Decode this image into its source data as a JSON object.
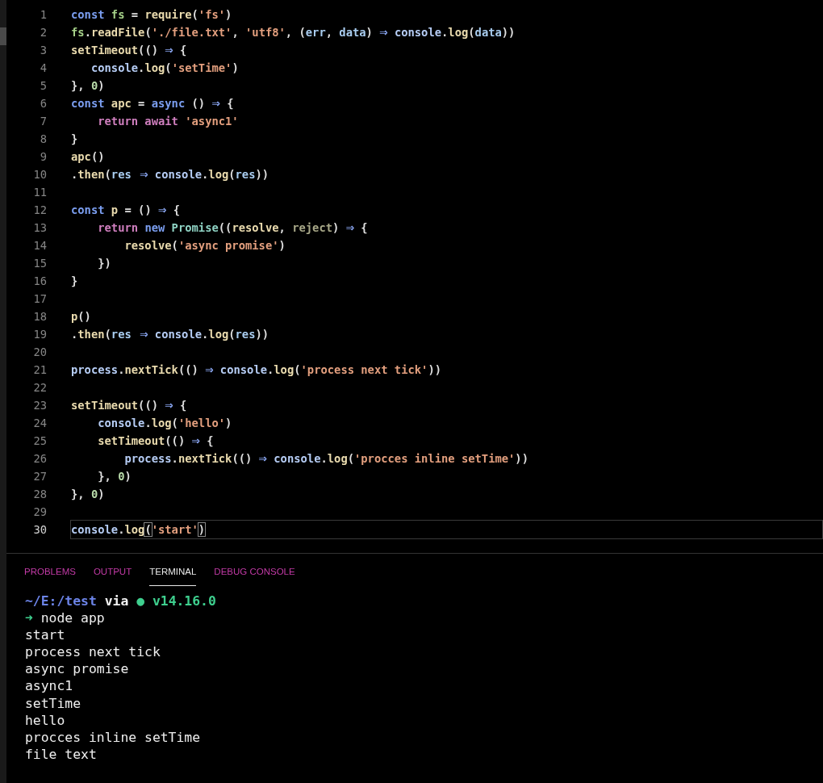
{
  "editor": {
    "lines": [
      {
        "number": "1",
        "current": false,
        "tokens": [
          {
            "kind": "kw",
            "text": "const"
          },
          {
            "kind": "var",
            "text": " fs"
          },
          {
            "kind": "pun",
            "text": " = "
          },
          {
            "kind": "fn",
            "text": "require"
          },
          {
            "kind": "pun",
            "text": "("
          },
          {
            "kind": "str",
            "text": "'fs'"
          },
          {
            "kind": "pun",
            "text": ")"
          }
        ]
      },
      {
        "number": "2",
        "current": false,
        "tokens": [
          {
            "kind": "var",
            "text": "fs"
          },
          {
            "kind": "pun",
            "text": "."
          },
          {
            "kind": "fn",
            "text": "readFile"
          },
          {
            "kind": "pun",
            "text": "("
          },
          {
            "kind": "str",
            "text": "'./file.txt'"
          },
          {
            "kind": "pun",
            "text": ", "
          },
          {
            "kind": "str",
            "text": "'utf8'"
          },
          {
            "kind": "pun",
            "text": ", ("
          },
          {
            "kind": "param",
            "text": "err"
          },
          {
            "kind": "pun",
            "text": ", "
          },
          {
            "kind": "param",
            "text": "data"
          },
          {
            "kind": "pun",
            "text": ") "
          },
          {
            "kind": "op",
            "text": "⇒"
          },
          {
            "kind": "obj",
            "text": " console"
          },
          {
            "kind": "pun",
            "text": "."
          },
          {
            "kind": "fn",
            "text": "log"
          },
          {
            "kind": "pun",
            "text": "("
          },
          {
            "kind": "param",
            "text": "data"
          },
          {
            "kind": "pun",
            "text": "))"
          }
        ]
      },
      {
        "number": "3",
        "current": false,
        "tokens": [
          {
            "kind": "fn",
            "text": "setTimeout"
          },
          {
            "kind": "pun",
            "text": "(() "
          },
          {
            "kind": "op",
            "text": "⇒"
          },
          {
            "kind": "pun",
            "text": " {"
          }
        ]
      },
      {
        "number": "4",
        "current": false,
        "tokens": [
          {
            "kind": "obj",
            "text": "   console"
          },
          {
            "kind": "pun",
            "text": "."
          },
          {
            "kind": "fn",
            "text": "log"
          },
          {
            "kind": "pun",
            "text": "("
          },
          {
            "kind": "str",
            "text": "'setTime'"
          },
          {
            "kind": "pun",
            "text": ")"
          }
        ]
      },
      {
        "number": "5",
        "current": false,
        "tokens": [
          {
            "kind": "pun",
            "text": "}, "
          },
          {
            "kind": "num",
            "text": "0"
          },
          {
            "kind": "pun",
            "text": ")"
          }
        ]
      },
      {
        "number": "6",
        "current": false,
        "tokens": [
          {
            "kind": "kw",
            "text": "const"
          },
          {
            "kind": "fn",
            "text": " apc"
          },
          {
            "kind": "pun",
            "text": " = "
          },
          {
            "kind": "kw",
            "text": "async"
          },
          {
            "kind": "pun",
            "text": " () "
          },
          {
            "kind": "op",
            "text": "⇒"
          },
          {
            "kind": "pun",
            "text": " {"
          }
        ]
      },
      {
        "number": "7",
        "current": false,
        "tokens": [
          {
            "kind": "ctl",
            "text": "    return await"
          },
          {
            "kind": "str",
            "text": " 'async1'"
          }
        ]
      },
      {
        "number": "8",
        "current": false,
        "tokens": [
          {
            "kind": "pun",
            "text": "}"
          }
        ]
      },
      {
        "number": "9",
        "current": false,
        "tokens": [
          {
            "kind": "fn",
            "text": "apc"
          },
          {
            "kind": "pun",
            "text": "()"
          }
        ]
      },
      {
        "number": "10",
        "current": false,
        "tokens": [
          {
            "kind": "pun",
            "text": "."
          },
          {
            "kind": "fn",
            "text": "then"
          },
          {
            "kind": "pun",
            "text": "("
          },
          {
            "kind": "param",
            "text": "res"
          },
          {
            "kind": "op",
            "text": " ⇒"
          },
          {
            "kind": "obj",
            "text": " console"
          },
          {
            "kind": "pun",
            "text": "."
          },
          {
            "kind": "fn",
            "text": "log"
          },
          {
            "kind": "pun",
            "text": "("
          },
          {
            "kind": "param",
            "text": "res"
          },
          {
            "kind": "pun",
            "text": "))"
          }
        ]
      },
      {
        "number": "11",
        "current": false
      },
      {
        "number": "12",
        "current": false,
        "tokens": [
          {
            "kind": "kw",
            "text": "const"
          },
          {
            "kind": "fn",
            "text": " p"
          },
          {
            "kind": "pun",
            "text": " = () "
          },
          {
            "kind": "op",
            "text": "⇒"
          },
          {
            "kind": "pun",
            "text": " {"
          }
        ]
      },
      {
        "number": "13",
        "current": false,
        "tokens": [
          {
            "kind": "ctl",
            "text": "    return"
          },
          {
            "kind": "kw",
            "text": " new"
          },
          {
            "kind": "cls",
            "text": " Promise"
          },
          {
            "kind": "pun",
            "text": "(("
          },
          {
            "kind": "fn",
            "text": "resolve"
          },
          {
            "kind": "pun",
            "text": ", "
          },
          {
            "kind": "unused",
            "text": "reject"
          },
          {
            "kind": "pun",
            "text": ") "
          },
          {
            "kind": "op",
            "text": "⇒"
          },
          {
            "kind": "pun",
            "text": " {"
          }
        ]
      },
      {
        "number": "14",
        "current": false,
        "tokens": [
          {
            "kind": "fn",
            "text": "        resolve"
          },
          {
            "kind": "pun",
            "text": "("
          },
          {
            "kind": "str",
            "text": "'async promise'"
          },
          {
            "kind": "pun",
            "text": ")"
          }
        ]
      },
      {
        "number": "15",
        "current": false,
        "tokens": [
          {
            "kind": "pun",
            "text": "    })"
          }
        ]
      },
      {
        "number": "16",
        "current": false,
        "tokens": [
          {
            "kind": "pun",
            "text": "}"
          }
        ]
      },
      {
        "number": "17",
        "current": false
      },
      {
        "number": "18",
        "current": false,
        "tokens": [
          {
            "kind": "fn",
            "text": "p"
          },
          {
            "kind": "pun",
            "text": "()"
          }
        ]
      },
      {
        "number": "19",
        "current": false,
        "tokens": [
          {
            "kind": "pun",
            "text": "."
          },
          {
            "kind": "fn",
            "text": "then"
          },
          {
            "kind": "pun",
            "text": "("
          },
          {
            "kind": "param",
            "text": "res"
          },
          {
            "kind": "op",
            "text": " ⇒"
          },
          {
            "kind": "obj",
            "text": " console"
          },
          {
            "kind": "pun",
            "text": "."
          },
          {
            "kind": "fn",
            "text": "log"
          },
          {
            "kind": "pun",
            "text": "("
          },
          {
            "kind": "param",
            "text": "res"
          },
          {
            "kind": "pun",
            "text": "))"
          }
        ]
      },
      {
        "number": "20",
        "current": false
      },
      {
        "number": "21",
        "current": false,
        "tokens": [
          {
            "kind": "obj",
            "text": "process"
          },
          {
            "kind": "pun",
            "text": "."
          },
          {
            "kind": "fn",
            "text": "nextTick"
          },
          {
            "kind": "pun",
            "text": "(() "
          },
          {
            "kind": "op",
            "text": "⇒"
          },
          {
            "kind": "obj",
            "text": " console"
          },
          {
            "kind": "pun",
            "text": "."
          },
          {
            "kind": "fn",
            "text": "log"
          },
          {
            "kind": "pun",
            "text": "("
          },
          {
            "kind": "str",
            "text": "'process next tick'"
          },
          {
            "kind": "pun",
            "text": "))"
          }
        ]
      },
      {
        "number": "22",
        "current": false
      },
      {
        "number": "23",
        "current": false,
        "tokens": [
          {
            "kind": "fn",
            "text": "setTimeout"
          },
          {
            "kind": "pun",
            "text": "(() "
          },
          {
            "kind": "op",
            "text": "⇒"
          },
          {
            "kind": "pun",
            "text": " {"
          }
        ]
      },
      {
        "number": "24",
        "current": false,
        "tokens": [
          {
            "kind": "obj",
            "text": "    console"
          },
          {
            "kind": "pun",
            "text": "."
          },
          {
            "kind": "fn",
            "text": "log"
          },
          {
            "kind": "pun",
            "text": "("
          },
          {
            "kind": "str",
            "text": "'hello'"
          },
          {
            "kind": "pun",
            "text": ")"
          }
        ]
      },
      {
        "number": "25",
        "current": false,
        "tokens": [
          {
            "kind": "fn",
            "text": "    setTimeout"
          },
          {
            "kind": "pun",
            "text": "(() "
          },
          {
            "kind": "op",
            "text": "⇒"
          },
          {
            "kind": "pun",
            "text": " {"
          }
        ]
      },
      {
        "number": "26",
        "current": false,
        "tokens": [
          {
            "kind": "obj",
            "text": "        process"
          },
          {
            "kind": "pun",
            "text": "."
          },
          {
            "kind": "fn",
            "text": "nextTick"
          },
          {
            "kind": "pun",
            "text": "(() "
          },
          {
            "kind": "op",
            "text": "⇒"
          },
          {
            "kind": "obj",
            "text": " console"
          },
          {
            "kind": "pun",
            "text": "."
          },
          {
            "kind": "fn",
            "text": "log"
          },
          {
            "kind": "pun",
            "text": "("
          },
          {
            "kind": "str",
            "text": "'procces inline setTime'"
          },
          {
            "kind": "pun",
            "text": "))"
          }
        ]
      },
      {
        "number": "27",
        "current": false,
        "tokens": [
          {
            "kind": "pun",
            "text": "    }, "
          },
          {
            "kind": "num",
            "text": "0"
          },
          {
            "kind": "pun",
            "text": ")"
          }
        ]
      },
      {
        "number": "28",
        "current": false,
        "tokens": [
          {
            "kind": "pun",
            "text": "}, "
          },
          {
            "kind": "num",
            "text": "0"
          },
          {
            "kind": "pun",
            "text": ")"
          }
        ]
      },
      {
        "number": "29",
        "current": false
      },
      {
        "number": "30",
        "current": true,
        "tokens": [
          {
            "kind": "obj",
            "text": "console"
          },
          {
            "kind": "pun",
            "text": "."
          },
          {
            "kind": "fn",
            "text": "log"
          },
          {
            "kind": "match",
            "text": "("
          },
          {
            "kind": "str",
            "text": "'start'"
          },
          {
            "kind": "match",
            "text": ")"
          }
        ]
      }
    ]
  },
  "panel": {
    "tabs": [
      {
        "label": "PROBLEMS",
        "selected": false
      },
      {
        "label": "OUTPUT",
        "selected": false
      },
      {
        "label": "TERMINAL",
        "selected": true
      },
      {
        "label": "DEBUG CONSOLE",
        "selected": false
      }
    ]
  },
  "terminal": {
    "lines": [
      [
        {
          "kind": "path",
          "text": "~/E:/test"
        },
        {
          "kind": "plain_bold",
          "text": " via "
        },
        {
          "kind": "node",
          "text": "● v14.16.0"
        }
      ],
      [
        {
          "kind": "arrow",
          "text": "➜"
        },
        {
          "kind": "plain",
          "text": " node app"
        }
      ],
      [
        {
          "kind": "plain",
          "text": "start"
        }
      ],
      [
        {
          "kind": "plain",
          "text": "process next tick"
        }
      ],
      [
        {
          "kind": "plain",
          "text": "async promise"
        }
      ],
      [
        {
          "kind": "plain",
          "text": "async1"
        }
      ],
      [
        {
          "kind": "plain",
          "text": "setTime"
        }
      ],
      [
        {
          "kind": "plain",
          "text": "hello"
        }
      ],
      [
        {
          "kind": "plain",
          "text": "procces inline setTime"
        }
      ],
      [
        {
          "kind": "plain",
          "text": "file text"
        }
      ]
    ]
  }
}
